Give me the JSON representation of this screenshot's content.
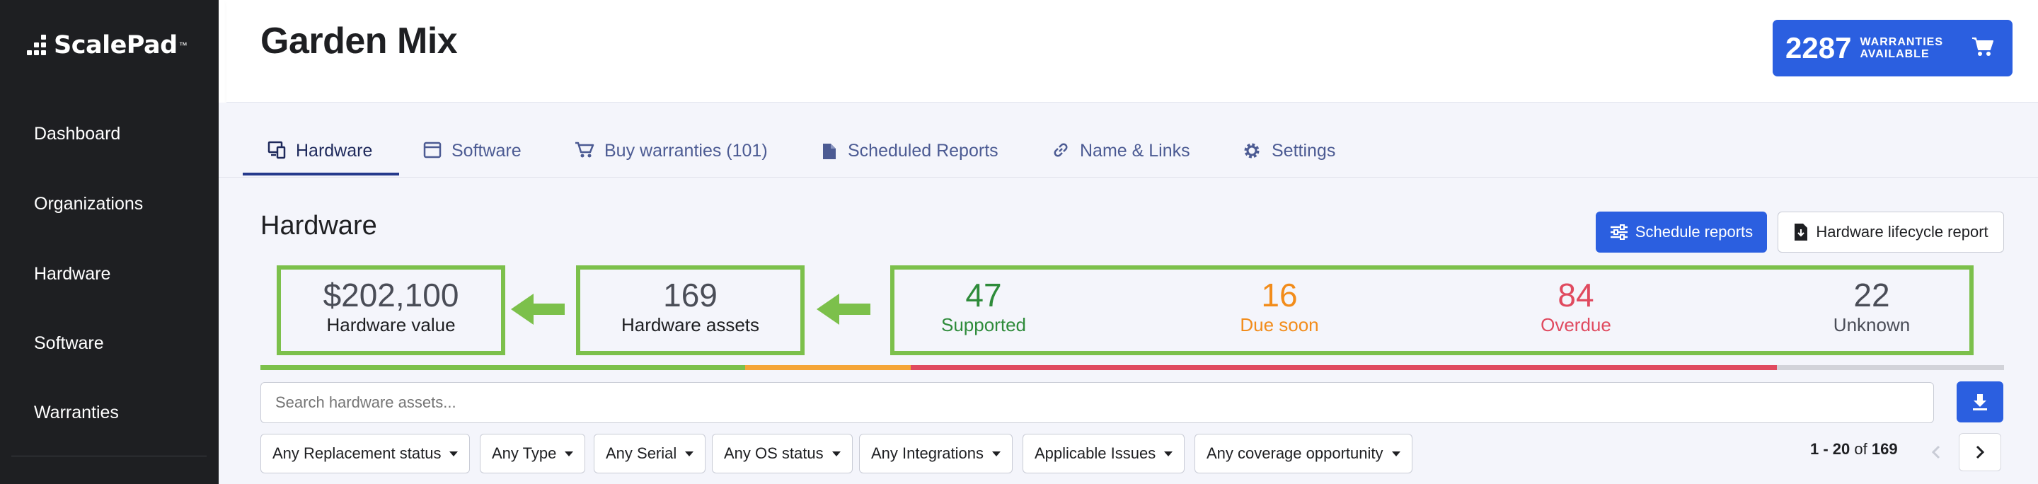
{
  "sidebar": {
    "brand": "ScalePad",
    "brand_tm": "™",
    "items": [
      {
        "label": "Dashboard"
      },
      {
        "label": "Organizations"
      },
      {
        "label": "Hardware"
      },
      {
        "label": "Software"
      },
      {
        "label": "Warranties"
      }
    ]
  },
  "header": {
    "title": "Garden Mix",
    "warranty_count": "2287",
    "warranty_label_1": "WARRANTIES",
    "warranty_label_2": "AVAILABLE",
    "warranty_icon": "cart-icon"
  },
  "tabs": [
    {
      "label": "Hardware",
      "icon": "hardware-icon",
      "active": true
    },
    {
      "label": "Software",
      "icon": "window-icon"
    },
    {
      "label": "Buy warranties (101)",
      "icon": "cart-icon"
    },
    {
      "label": "Scheduled Reports",
      "icon": "document-icon"
    },
    {
      "label": "Name & Links",
      "icon": "link-icon"
    },
    {
      "label": "Settings",
      "icon": "gear-icon"
    }
  ],
  "main": {
    "title": "Hardware",
    "schedule_button": "Schedule reports",
    "lifecycle_button": "Hardware lifecycle report",
    "stats": {
      "value": {
        "num": "$202,100",
        "label": "Hardware value"
      },
      "assets": {
        "num": "169",
        "label": "Hardware assets"
      },
      "supported": {
        "num": "47",
        "label": "Supported"
      },
      "due_soon": {
        "num": "16",
        "label": "Due soon"
      },
      "overdue": {
        "num": "84",
        "label": "Overdue"
      },
      "unknown": {
        "num": "22",
        "label": "Unknown"
      }
    },
    "search_placeholder": "Search hardware assets...",
    "filters": [
      "Any Replacement status",
      "Any Type",
      "Any Serial",
      "Any OS status",
      "Any Integrations",
      "Applicable Issues",
      "Any coverage opportunity"
    ],
    "pagination": {
      "range": "1 - 20",
      "of": "of",
      "total": "169"
    }
  },
  "colors": {
    "accent": "#2b5fe0",
    "highlight": "#7cc04b",
    "supported": "#2e8b3a",
    "due_soon": "#f28c1a",
    "overdue": "#e04a5f",
    "unknown": "#4a4d57"
  }
}
